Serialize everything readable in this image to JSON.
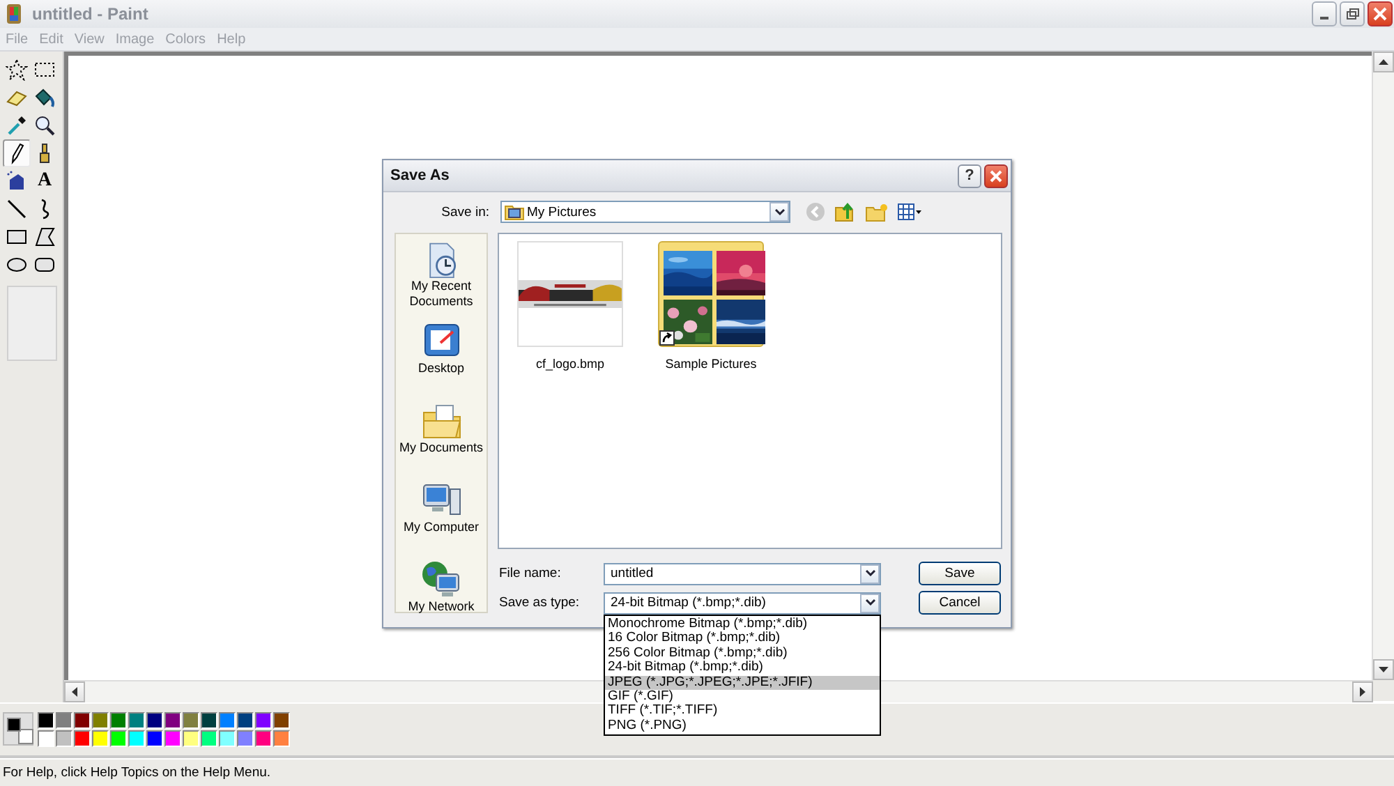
{
  "window": {
    "title": "untitled - Paint"
  },
  "menu": [
    "File",
    "Edit",
    "View",
    "Image",
    "Colors",
    "Help"
  ],
  "tools": [
    {
      "kind": "free-select",
      "selected": false
    },
    {
      "kind": "select",
      "selected": false
    },
    {
      "kind": "eraser",
      "selected": false
    },
    {
      "kind": "fill",
      "selected": false
    },
    {
      "kind": "picker",
      "selected": false
    },
    {
      "kind": "magnifier",
      "selected": false
    },
    {
      "kind": "pencil",
      "selected": true
    },
    {
      "kind": "brush",
      "selected": false
    },
    {
      "kind": "airbrush",
      "selected": false
    },
    {
      "kind": "text",
      "label": "A",
      "selected": false
    },
    {
      "kind": "line",
      "selected": false
    },
    {
      "kind": "curve",
      "selected": false
    },
    {
      "kind": "rectangle",
      "selected": false
    },
    {
      "kind": "polygon",
      "selected": false
    },
    {
      "kind": "ellipse",
      "selected": false
    },
    {
      "kind": "rounded-rectangle",
      "selected": false
    }
  ],
  "palette": {
    "foreground": {
      "color": "#000000"
    },
    "background": {
      "color": "#ffffff"
    },
    "colors": [
      {
        "color": "#000000"
      },
      {
        "color": "#808080"
      },
      {
        "color": "#800000"
      },
      {
        "color": "#808000"
      },
      {
        "color": "#008000"
      },
      {
        "color": "#008080"
      },
      {
        "color": "#000080"
      },
      {
        "color": "#800080"
      },
      {
        "color": "#808040"
      },
      {
        "color": "#004040"
      },
      {
        "color": "#0080ff"
      },
      {
        "color": "#004080"
      },
      {
        "color": "#8000ff"
      },
      {
        "color": "#804000"
      },
      {
        "color": "#ffffff"
      },
      {
        "color": "#c0c0c0"
      },
      {
        "color": "#ff0000"
      },
      {
        "color": "#ffff00"
      },
      {
        "color": "#00ff00"
      },
      {
        "color": "#00ffff"
      },
      {
        "color": "#0000ff"
      },
      {
        "color": "#ff00ff"
      },
      {
        "color": "#ffff80"
      },
      {
        "color": "#00ff80"
      },
      {
        "color": "#80ffff"
      },
      {
        "color": "#8080ff"
      },
      {
        "color": "#ff0080"
      },
      {
        "color": "#ff8040"
      }
    ]
  },
  "status_bar": "For Help, click Help Topics on the Help Menu.",
  "dialog": {
    "title": "Save As",
    "help_button": "?",
    "save_in_label": "Save in:",
    "save_in_value": "My Pictures",
    "places": [
      {
        "kind": "recent",
        "label": "My Recent Documents"
      },
      {
        "kind": "desktop",
        "label": "Desktop"
      },
      {
        "kind": "documents",
        "label": "My Documents"
      },
      {
        "kind": "computer",
        "label": "My Computer"
      },
      {
        "kind": "network",
        "label": "My Network"
      }
    ],
    "files": [
      {
        "name": "cf_logo.bmp"
      },
      {
        "kind": "folder",
        "name": "Sample Pictures"
      }
    ],
    "file_name_label": "File name:",
    "file_name": "untitled",
    "type_label": "Save as type:",
    "type_value": "24-bit Bitmap (*.bmp;*.dib)",
    "type_options": [
      {
        "label": "Monochrome Bitmap (*.bmp;*.dib)",
        "selected": false
      },
      {
        "label": "16 Color Bitmap (*.bmp;*.dib)",
        "selected": false
      },
      {
        "label": "256 Color Bitmap (*.bmp;*.dib)",
        "selected": false
      },
      {
        "label": "24-bit Bitmap (*.bmp;*.dib)",
        "selected": false
      },
      {
        "label": "JPEG (*.JPG;*.JPEG;*.JPE;*.JFIF)",
        "selected": true
      },
      {
        "label": "GIF (*.GIF)",
        "selected": false
      },
      {
        "label": "TIFF (*.TIF;*.TIFF)",
        "selected": false
      },
      {
        "label": "PNG (*.PNG)",
        "selected": false
      }
    ],
    "buttons": [
      "Save",
      "Cancel"
    ]
  }
}
